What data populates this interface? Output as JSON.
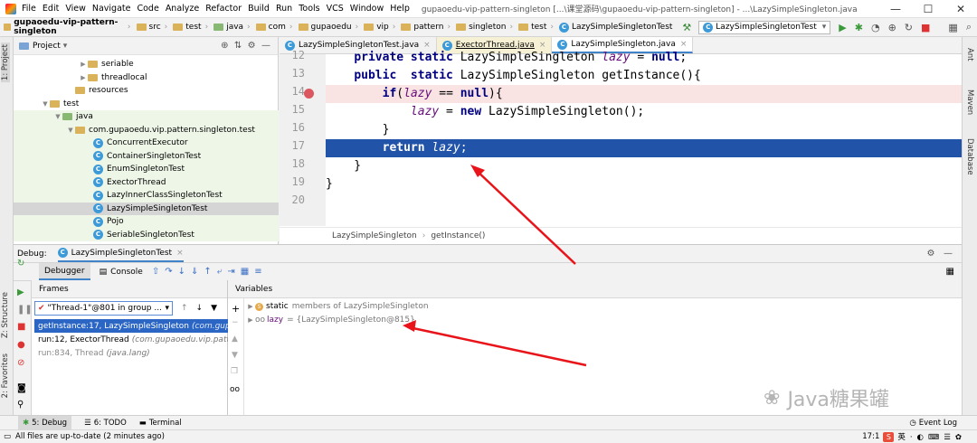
{
  "menu": [
    "File",
    "Edit",
    "View",
    "Navigate",
    "Code",
    "Analyze",
    "Refactor",
    "Build",
    "Run",
    "Tools",
    "VCS",
    "Window",
    "Help"
  ],
  "window_title": "gupaoedu-vip-pattern-singleton [...\\课堂源码\\gupaoedu-vip-pattern-singleton] - ...\\LazySimpleSingleton.java",
  "breadcrumbs": [
    "gupaoedu-vip-pattern-singleton",
    "src",
    "test",
    "java",
    "com",
    "gupaoedu",
    "vip",
    "pattern",
    "singleton",
    "test",
    "LazySimpleSingletonTest"
  ],
  "run_config": "LazySimpleSingletonTest",
  "left_strip": {
    "project": "1: Project",
    "structure": "Z: Structure",
    "favorites": "2: Favorites"
  },
  "right_strip": {
    "ant": "Ant",
    "maven": "Maven",
    "database": "Database"
  },
  "project": {
    "header": "Project",
    "tree": [
      {
        "label": "seriable",
        "type": "folder",
        "depth": 5
      },
      {
        "label": "threadlocal",
        "type": "folder",
        "depth": 5
      },
      {
        "label": "resources",
        "type": "folder",
        "depth": 4
      },
      {
        "label": "test",
        "type": "folder",
        "depth": 3
      },
      {
        "label": "java",
        "type": "folder-green",
        "depth": 4
      },
      {
        "label": "com.gupaoedu.vip.pattern.singleton.test",
        "type": "package",
        "depth": 5
      },
      {
        "label": "ConcurrentExecutor",
        "type": "class",
        "depth": 6
      },
      {
        "label": "ContainerSingletonTest",
        "type": "class",
        "depth": 6
      },
      {
        "label": "EnumSingletonTest",
        "type": "class",
        "depth": 6
      },
      {
        "label": "ExectorThread",
        "type": "class",
        "depth": 6
      },
      {
        "label": "LazyInnerClassSingletonTest",
        "type": "class",
        "depth": 6
      },
      {
        "label": "LazySimpleSingletonTest",
        "type": "class",
        "depth": 6
      },
      {
        "label": "Pojo",
        "type": "class",
        "depth": 6
      },
      {
        "label": "SeriableSingletonTest",
        "type": "class",
        "depth": 6
      }
    ]
  },
  "editor": {
    "tabs": [
      {
        "label": "LazySimpleSingletonTest.java",
        "active": false
      },
      {
        "label": "ExectorThread.java",
        "active": false
      },
      {
        "label": "LazySimpleSingleton.java",
        "active": true
      }
    ],
    "lines": [
      {
        "num": "12",
        "text": "    private static LazySimpleSingleton lazy = null;"
      },
      {
        "num": "13",
        "text": "    public  static LazySimpleSingleton getInstance(){"
      },
      {
        "num": "14",
        "text": "        if(lazy == null){"
      },
      {
        "num": "15",
        "text": "            lazy = new LazySimpleSingleton();"
      },
      {
        "num": "16",
        "text": "        }"
      },
      {
        "num": "17",
        "text": "        return lazy;"
      },
      {
        "num": "18",
        "text": "    }"
      },
      {
        "num": "19",
        "text": "}"
      },
      {
        "num": "20",
        "text": ""
      }
    ],
    "breadcrumb": [
      "LazySimpleSingleton",
      "getInstance()"
    ]
  },
  "debug": {
    "label": "Debug:",
    "session": "LazySimpleSingletonTest",
    "tab_debugger": "Debugger",
    "tab_console": "Console",
    "frames_header": "Frames",
    "thread": "\"Thread-1\"@801 in group ...",
    "frames": [
      {
        "method": "getInstance:17, LazySimpleSingleton",
        "pkg": "(com.gupaoedu.vip.pattern.singleton.lazy)"
      },
      {
        "method": "run:12, ExectorThread",
        "pkg": "(com.gupaoedu.vip.pattern.singleton.test)"
      },
      {
        "method": "run:834, Thread",
        "pkg": "(java.lang)"
      }
    ],
    "variables_header": "Variables",
    "variables": [
      {
        "name": "static",
        "value": "members of LazySimpleSingleton"
      },
      {
        "name": "lazy",
        "value": "= {LazySimpleSingleton@815}"
      }
    ]
  },
  "bottom_tabs": [
    "5: Debug",
    "6: TODO",
    "Terminal"
  ],
  "event_log": "Event Log",
  "status": "All files are up-to-date (2 minutes ago)",
  "position": "17:1",
  "watermark": "Java糖果罐"
}
